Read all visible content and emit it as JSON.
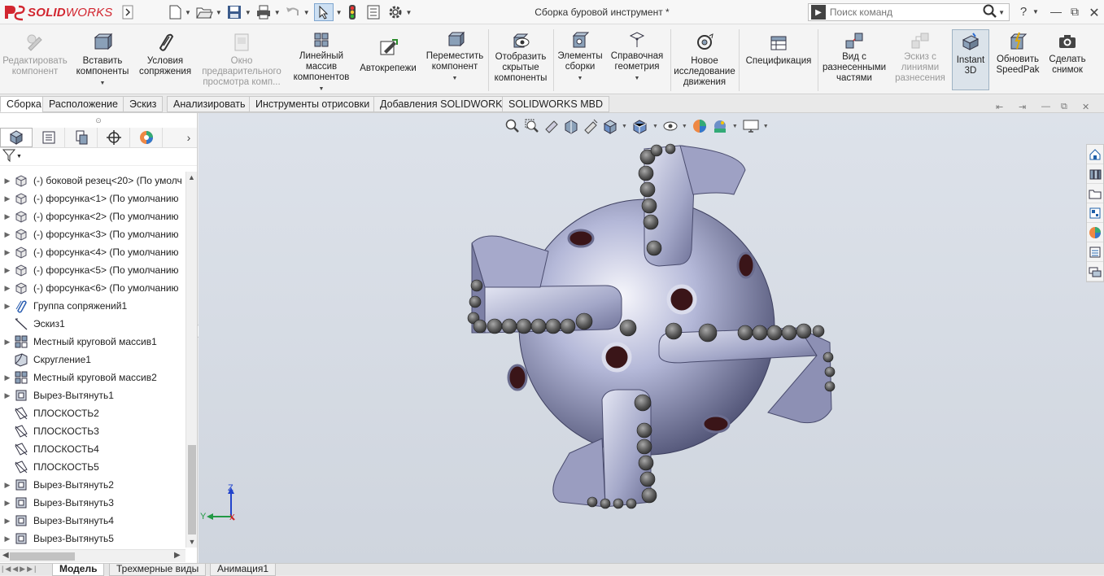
{
  "app": {
    "window_title": "Сборка буровой инструмент *",
    "search_placeholder": "Поиск команд",
    "help": "?",
    "logo_prefix": "SOLID",
    "logo_suffix": "WORKS"
  },
  "ribbon": {
    "buttons": [
      {
        "label": "Редактировать компонент",
        "enabled": false,
        "icon": "edit-component-icon"
      },
      {
        "label": "Вставить компоненты",
        "enabled": true,
        "icon": "insert-components-icon"
      },
      {
        "label": "Условия сопряжения",
        "enabled": true,
        "icon": "mate-icon"
      },
      {
        "label": "Окно предварительного просмотра комп...",
        "enabled": false,
        "icon": "preview-window-icon"
      },
      {
        "label": "Линейный массив компонентов",
        "enabled": true,
        "icon": "linear-pattern-icon"
      },
      {
        "label": "Автокрепежи",
        "enabled": true,
        "icon": "smart-fasteners-icon"
      },
      {
        "label": "Переместить компонент",
        "enabled": true,
        "icon": "move-component-icon"
      },
      {
        "label": "Отобразить скрытые компоненты",
        "enabled": true,
        "icon": "show-hidden-icon"
      },
      {
        "label": "Элементы сборки",
        "enabled": true,
        "icon": "assembly-features-icon"
      },
      {
        "label": "Справочная геометрия",
        "enabled": true,
        "icon": "reference-geometry-icon"
      },
      {
        "label": "Новое исследование движения",
        "enabled": true,
        "icon": "motion-study-icon"
      },
      {
        "label": "Спецификация",
        "enabled": true,
        "icon": "bom-icon"
      },
      {
        "label": "Вид с разнесенными частями",
        "enabled": true,
        "icon": "exploded-view-icon"
      },
      {
        "label": "Эскиз с линиями разнесения",
        "enabled": false,
        "icon": "explode-line-sketch-icon"
      },
      {
        "label": "Instant 3D",
        "enabled": true,
        "active": true,
        "icon": "instant3d-icon"
      },
      {
        "label": "Обновить SpeedPak",
        "enabled": true,
        "icon": "speedpak-icon"
      },
      {
        "label": "Сделать снимок",
        "enabled": true,
        "icon": "snapshot-icon"
      }
    ]
  },
  "tabs": [
    "Сборка",
    "Расположение",
    "Эскиз",
    "Анализировать",
    "Инструменты отрисовки",
    "Добавления SOLIDWORKS",
    "SOLIDWORKS MBD"
  ],
  "tree": {
    "items": [
      {
        "label": "(-) боковой резец<20> (По умолч",
        "icon": "part-icon"
      },
      {
        "label": "(-) форсунка<1> (По умолчанию",
        "icon": "part-icon"
      },
      {
        "label": "(-) форсунка<2> (По умолчанию",
        "icon": "part-icon"
      },
      {
        "label": "(-) форсунка<3> (По умолчанию",
        "icon": "part-icon"
      },
      {
        "label": "(-) форсунка<4> (По умолчанию",
        "icon": "part-icon"
      },
      {
        "label": "(-) форсунка<5> (По умолчанию",
        "icon": "part-icon"
      },
      {
        "label": "(-) форсунка<6> (По умолчанию",
        "icon": "part-icon"
      },
      {
        "label": "Группа сопряжений1",
        "icon": "mates-group-icon"
      },
      {
        "label": "Эскиз1",
        "icon": "sketch-icon"
      },
      {
        "label": "Местный круговой массив1",
        "icon": "circular-pattern-icon"
      },
      {
        "label": "Скругление1",
        "icon": "fillet-icon"
      },
      {
        "label": "Местный круговой массив2",
        "icon": "circular-pattern-icon"
      },
      {
        "label": "Вырез-Вытянуть1",
        "icon": "cut-extrude-icon"
      },
      {
        "label": "ПЛОСКОСТЬ2",
        "icon": "plane-icon"
      },
      {
        "label": "ПЛОСКОСТЬ3",
        "icon": "plane-icon"
      },
      {
        "label": "ПЛОСКОСТЬ4",
        "icon": "plane-icon"
      },
      {
        "label": "ПЛОСКОСТЬ5",
        "icon": "plane-icon"
      },
      {
        "label": "Вырез-Вытянуть2",
        "icon": "cut-extrude-icon"
      },
      {
        "label": "Вырез-Вытянуть3",
        "icon": "cut-extrude-icon"
      },
      {
        "label": "Вырез-Вытянуть4",
        "icon": "cut-extrude-icon"
      },
      {
        "label": "Вырез-Вытянуть5",
        "icon": "cut-extrude-icon"
      }
    ]
  },
  "triad": {
    "z": "Z",
    "y": "Y",
    "x": "X"
  },
  "bottom_tabs": [
    "Модель",
    "Трехмерные виды",
    "Анимация1"
  ],
  "colors": {
    "accent": "#d22630",
    "selection": "#dbe3ea",
    "model": "#a8acd0"
  }
}
